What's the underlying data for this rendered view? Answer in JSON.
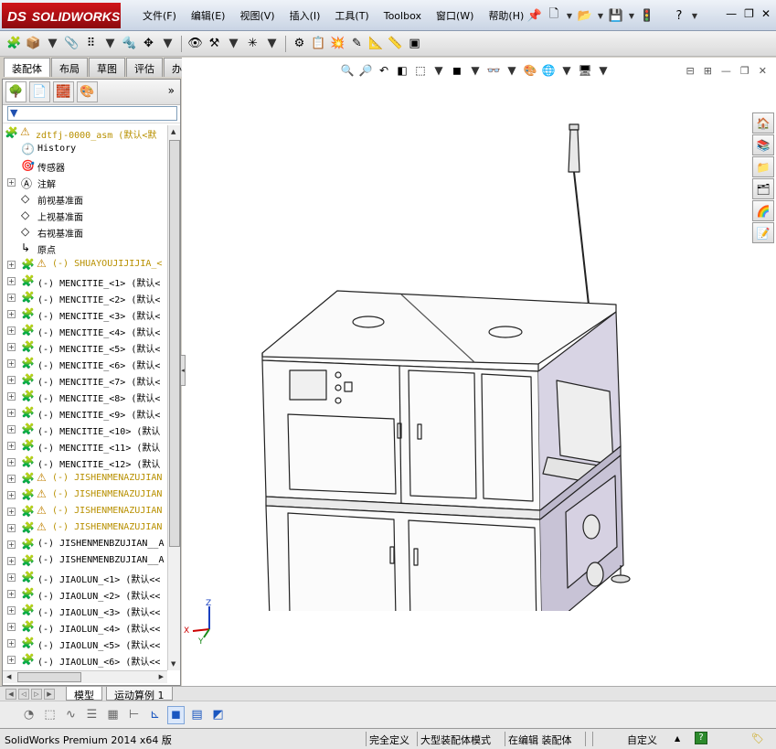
{
  "app": {
    "logo_text": "SOLIDWORKS",
    "logo_ds": "DS",
    "menu": [
      "文件(F)",
      "编辑(E)",
      "视图(V)",
      "插入(I)",
      "工具(T)",
      "Toolbox",
      "窗口(W)",
      "帮助(H)"
    ],
    "help_glyph": "?",
    "colors": {
      "brand": "#c8161d",
      "accent": "#1a56c0",
      "panel_bg": "#ffffff",
      "chrome": "#d4d0c8"
    }
  },
  "command_tabs": [
    "装配体",
    "布局",
    "草图",
    "评估",
    "办公室产品"
  ],
  "tree": {
    "expand_label": "»",
    "rows": [
      {
        "label": "zdtfj-0000_asm  (默认<默",
        "icon": "assembly-icon",
        "warn": true,
        "twisty": "",
        "color": "yellow",
        "indent": 0
      },
      {
        "label": "History",
        "icon": "history-icon",
        "warn": false,
        "twisty": "",
        "color": "",
        "indent": 1
      },
      {
        "label": "传感器",
        "icon": "sensor-icon",
        "warn": false,
        "twisty": "",
        "color": "",
        "indent": 1
      },
      {
        "label": "注解",
        "icon": "annotation-icon",
        "warn": false,
        "twisty": "+",
        "color": "",
        "indent": 1
      },
      {
        "label": "前视基准面",
        "icon": "plane-icon",
        "warn": false,
        "twisty": "",
        "color": "",
        "indent": 1
      },
      {
        "label": "上视基准面",
        "icon": "plane-icon",
        "warn": false,
        "twisty": "",
        "color": "",
        "indent": 1
      },
      {
        "label": "右视基准面",
        "icon": "plane-icon",
        "warn": false,
        "twisty": "",
        "color": "",
        "indent": 1
      },
      {
        "label": "原点",
        "icon": "origin-icon",
        "warn": false,
        "twisty": "",
        "color": "",
        "indent": 1
      },
      {
        "label": "(-) SHUAYOUJIJIJIA_<",
        "icon": "subassembly-icon",
        "warn": true,
        "twisty": "+",
        "color": "yellow",
        "indent": 1
      },
      {
        "label": "(-) MENCITIE_<1> (默认<",
        "icon": "part-icon",
        "warn": false,
        "twisty": "+",
        "color": "",
        "indent": 1
      },
      {
        "label": "(-) MENCITIE_<2> (默认<",
        "icon": "part-icon",
        "warn": false,
        "twisty": "+",
        "color": "",
        "indent": 1
      },
      {
        "label": "(-) MENCITIE_<3> (默认<",
        "icon": "part-icon",
        "warn": false,
        "twisty": "+",
        "color": "",
        "indent": 1
      },
      {
        "label": "(-) MENCITIE_<4> (默认<",
        "icon": "part-icon",
        "warn": false,
        "twisty": "+",
        "color": "",
        "indent": 1
      },
      {
        "label": "(-) MENCITIE_<5> (默认<",
        "icon": "part-icon",
        "warn": false,
        "twisty": "+",
        "color": "",
        "indent": 1
      },
      {
        "label": "(-) MENCITIE_<6> (默认<",
        "icon": "part-icon",
        "warn": false,
        "twisty": "+",
        "color": "",
        "indent": 1
      },
      {
        "label": "(-) MENCITIE_<7> (默认<",
        "icon": "part-icon",
        "warn": false,
        "twisty": "+",
        "color": "",
        "indent": 1
      },
      {
        "label": "(-) MENCITIE_<8> (默认<",
        "icon": "part-icon",
        "warn": false,
        "twisty": "+",
        "color": "",
        "indent": 1
      },
      {
        "label": "(-) MENCITIE_<9> (默认<",
        "icon": "part-icon",
        "warn": false,
        "twisty": "+",
        "color": "",
        "indent": 1
      },
      {
        "label": "(-) MENCITIE_<10> (默认",
        "icon": "part-icon",
        "warn": false,
        "twisty": "+",
        "color": "",
        "indent": 1
      },
      {
        "label": "(-) MENCITIE_<11> (默认",
        "icon": "part-icon",
        "warn": false,
        "twisty": "+",
        "color": "",
        "indent": 1
      },
      {
        "label": "(-) MENCITIE_<12> (默认",
        "icon": "part-icon",
        "warn": false,
        "twisty": "+",
        "color": "",
        "indent": 1
      },
      {
        "label": "(-) JISHENMENAZUJIAN",
        "icon": "subassembly-icon",
        "warn": true,
        "twisty": "+",
        "color": "yellow",
        "indent": 1
      },
      {
        "label": "(-) JISHENMENAZUJIAN",
        "icon": "subassembly-icon",
        "warn": true,
        "twisty": "+",
        "color": "yellow",
        "indent": 1
      },
      {
        "label": "(-) JISHENMENAZUJIAN",
        "icon": "subassembly-icon",
        "warn": true,
        "twisty": "+",
        "color": "yellow",
        "indent": 1
      },
      {
        "label": "(-) JISHENMENAZUJIAN",
        "icon": "subassembly-icon",
        "warn": true,
        "twisty": "+",
        "color": "yellow",
        "indent": 1
      },
      {
        "label": "(-) JISHENMENBZUJIAN__A",
        "icon": "subassembly-icon",
        "warn": false,
        "twisty": "+",
        "color": "",
        "indent": 1
      },
      {
        "label": "(-) JISHENMENBZUJIAN__A",
        "icon": "subassembly-icon",
        "warn": false,
        "twisty": "+",
        "color": "",
        "indent": 1
      },
      {
        "label": "(-) JIAOLUN_<1> (默认<<",
        "icon": "part-icon",
        "warn": false,
        "twisty": "+",
        "color": "",
        "indent": 1
      },
      {
        "label": "(-) JIAOLUN_<2> (默认<<",
        "icon": "part-icon",
        "warn": false,
        "twisty": "+",
        "color": "",
        "indent": 1
      },
      {
        "label": "(-) JIAOLUN_<3> (默认<<",
        "icon": "part-icon",
        "warn": false,
        "twisty": "+",
        "color": "",
        "indent": 1
      },
      {
        "label": "(-) JIAOLUN_<4> (默认<<",
        "icon": "part-icon",
        "warn": false,
        "twisty": "+",
        "color": "",
        "indent": 1
      },
      {
        "label": "(-) JIAOLUN_<5> (默认<<",
        "icon": "part-icon",
        "warn": false,
        "twisty": "+",
        "color": "",
        "indent": 1
      },
      {
        "label": "(-) JIAOLUN_<6> (默认<<",
        "icon": "part-icon",
        "warn": false,
        "twisty": "+",
        "color": "",
        "indent": 1
      }
    ]
  },
  "bottom_tabs": [
    "模型",
    "运动算例 1"
  ],
  "triad": {
    "x": "X",
    "y": "Y",
    "z": "Z"
  },
  "status": {
    "version": "SolidWorks Premium 2014 x64 版",
    "fully_defined": "完全定义",
    "large_mode": "大型装配体模式",
    "editing": "在编辑 装配体",
    "custom": "自定义"
  }
}
